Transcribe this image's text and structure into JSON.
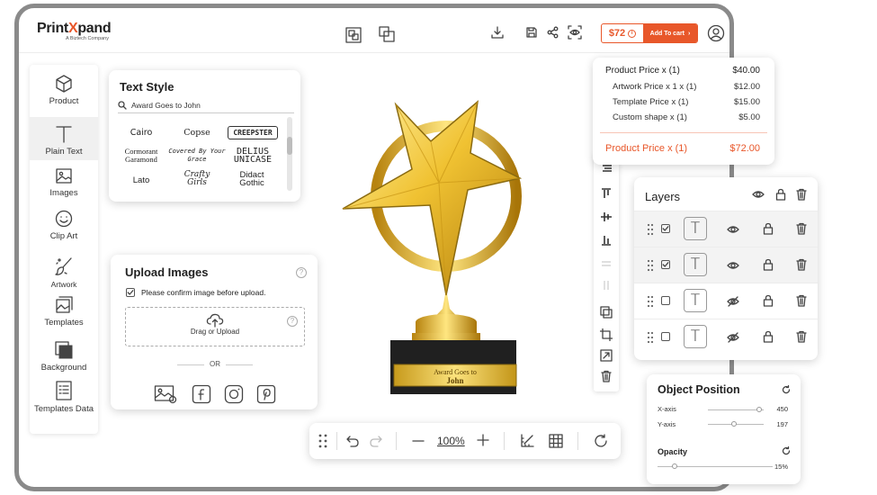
{
  "header": {
    "logo_prefix": "Print",
    "logo_x": "X",
    "logo_suffix": "pand",
    "logo_sub": "A Biztech Company",
    "price": "$72",
    "price_info": "i",
    "add_to_cart": "Add To cart",
    "cart_chevron": "›"
  },
  "sidebar": {
    "items": [
      {
        "label": "Product",
        "icon": "cube-icon"
      },
      {
        "label": "Plain Text",
        "icon": "text-icon"
      },
      {
        "label": "Images",
        "icon": "image-icon"
      },
      {
        "label": "Clip Art",
        "icon": "smiley-icon"
      },
      {
        "label": "Artwork",
        "icon": "brush-icon"
      },
      {
        "label": "Templates",
        "icon": "templates-icon"
      },
      {
        "label": "Background",
        "icon": "background-icon"
      },
      {
        "label": "Templates Data",
        "icon": "templates-data-icon"
      }
    ]
  },
  "text_style": {
    "title": "Text Style",
    "search_value": "Award Goes to John",
    "fonts": [
      "Cairo",
      "Copse",
      "CREEPSTER",
      "Cormorant Garamond",
      "Covered By Your Grace",
      "DELIUS UNICASE",
      "Lato",
      "Crafty Girls",
      "Didact Gothic"
    ]
  },
  "upload": {
    "title": "Upload Images",
    "help": "?",
    "confirm_label": "Please confirm image before upload.",
    "drop_label": "Drag or Upload",
    "or": "OR"
  },
  "toolbar": {
    "zoom": "100%"
  },
  "price_popup": {
    "main": {
      "label": "Product Price x (1)",
      "value": "$40.00"
    },
    "items": [
      {
        "label": "Artwork Price x 1 x (1)",
        "value": "$12.00"
      },
      {
        "label": "Template Price x (1)",
        "value": "$15.00"
      },
      {
        "label": "Custom shape x (1)",
        "value": "$5.00"
      }
    ],
    "total": {
      "label": "Product Price x (1)",
      "value": "$72.00"
    }
  },
  "canvas": {
    "plaque_line1": "Award Goes to",
    "plaque_line2": "John"
  },
  "layers": {
    "title": "Layers",
    "type_glyph": "T",
    "rows": [
      {
        "checked": true,
        "visible": true
      },
      {
        "checked": true,
        "visible": true
      },
      {
        "checked": false,
        "visible": false
      },
      {
        "checked": false,
        "visible": false
      }
    ]
  },
  "object_position": {
    "title": "Object Position",
    "x_label": "X-axis",
    "x_value": "450",
    "y_label": "Y-axis",
    "y_value": "197",
    "opacity_label": "Opacity",
    "opacity_value": "15%"
  },
  "colors": {
    "accent": "#e8572a",
    "gold": "#e9b82a"
  }
}
